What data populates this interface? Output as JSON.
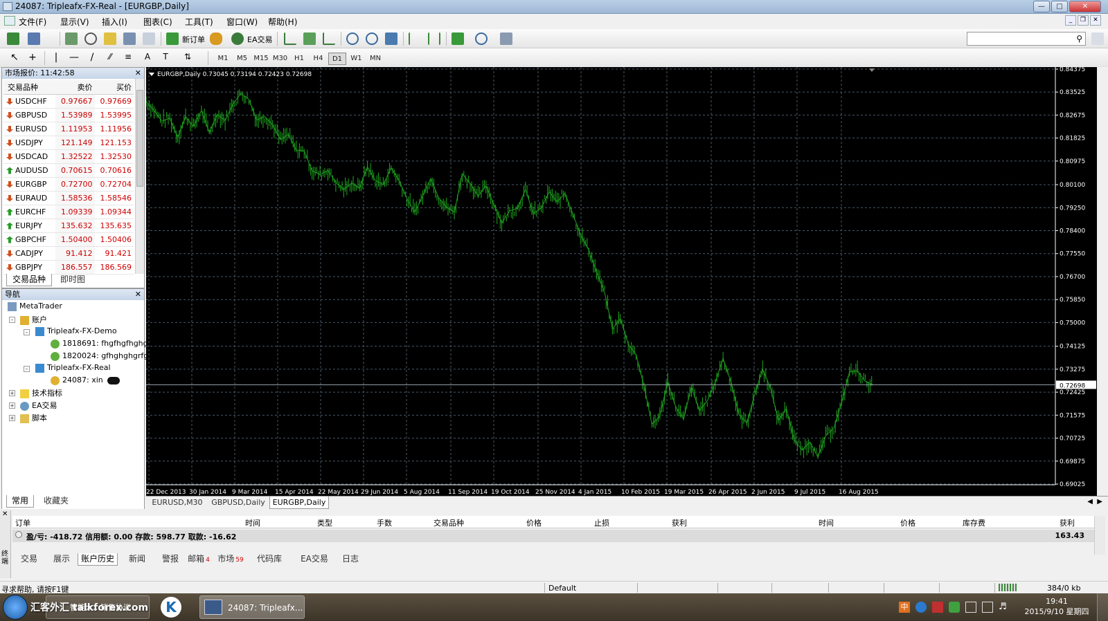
{
  "window": {
    "title": "24087: Tripleafx-FX-Real - [EURGBP,Daily]"
  },
  "menu": [
    "文件(F)",
    "显示(V)",
    "插入(I)",
    "图表(C)",
    "工具(T)",
    "窗口(W)",
    "帮助(H)"
  ],
  "toolbar": {
    "new_order": "新订单",
    "ea_trading": "EA交易"
  },
  "timeframes": [
    "M1",
    "M5",
    "M15",
    "M30",
    "H1",
    "H4",
    "D1",
    "W1",
    "MN"
  ],
  "active_timeframe": "D1",
  "market_watch": {
    "title": "市场报价: 11:42:58",
    "headers": [
      "交易品种",
      "卖价",
      "买价"
    ],
    "rows": [
      {
        "symbol": "USDCHF",
        "bid": "0.97667",
        "ask": "0.97669",
        "dir": "down"
      },
      {
        "symbol": "GBPUSD",
        "bid": "1.53989",
        "ask": "1.53995",
        "dir": "down"
      },
      {
        "symbol": "EURUSD",
        "bid": "1.11953",
        "ask": "1.11956",
        "dir": "down"
      },
      {
        "symbol": "USDJPY",
        "bid": "121.149",
        "ask": "121.153",
        "dir": "down"
      },
      {
        "symbol": "USDCAD",
        "bid": "1.32522",
        "ask": "1.32530",
        "dir": "down"
      },
      {
        "symbol": "AUDUSD",
        "bid": "0.70615",
        "ask": "0.70616",
        "dir": "up"
      },
      {
        "symbol": "EURGBP",
        "bid": "0.72700",
        "ask": "0.72704",
        "dir": "down"
      },
      {
        "symbol": "EURAUD",
        "bid": "1.58536",
        "ask": "1.58546",
        "dir": "down"
      },
      {
        "symbol": "EURCHF",
        "bid": "1.09339",
        "ask": "1.09344",
        "dir": "up"
      },
      {
        "symbol": "EURJPY",
        "bid": "135.632",
        "ask": "135.635",
        "dir": "up"
      },
      {
        "symbol": "GBPCHF",
        "bid": "1.50400",
        "ask": "1.50406",
        "dir": "up"
      },
      {
        "symbol": "CADJPY",
        "bid": "91.412",
        "ask": "91.421",
        "dir": "down"
      },
      {
        "symbol": "GBPJPY",
        "bid": "186.557",
        "ask": "186.569",
        "dir": "down"
      }
    ],
    "tabs": [
      "交易品种",
      "即时图"
    ]
  },
  "navigator": {
    "title": "导航",
    "items": {
      "root": "MetaTrader",
      "accounts": "账户",
      "demo_server": "Tripleafx-FX-Demo",
      "demo_acc1": "1818691: fhgfhgfhghg",
      "demo_acc2": "1820024: gfhghghgrfg",
      "real_server": "Tripleafx-FX-Real",
      "real_acc": "24087: xin",
      "indicators": "技术指标",
      "experts": "EA交易",
      "scripts": "脚本"
    },
    "tabs": [
      "常用",
      "收藏夹"
    ]
  },
  "chart": {
    "header": "EURGBP,Daily  0.73045 0.73194 0.72423 0.72698",
    "tabs": [
      "EURUSD,M30",
      "GBPUSD,Daily",
      "EURGBP,Daily"
    ],
    "active_tab": "EURGBP,Daily",
    "colors": {
      "bg": "#000000",
      "grid": "#4a5a68",
      "candle": "#1faa1f",
      "axis_text": "#ffffff"
    }
  },
  "chart_data": {
    "type": "line",
    "title": "EURGBP,Daily",
    "ylim": [
      0.69,
      0.8445
    ],
    "y_ticks": [
      "0.84375",
      "0.83525",
      "0.82675",
      "0.81825",
      "0.80975",
      "0.80100",
      "0.79250",
      "0.78400",
      "0.77550",
      "0.76700",
      "0.75850",
      "0.75000",
      "0.74125",
      "0.73275",
      "0.72425",
      "0.71575",
      "0.70725",
      "0.69875",
      "0.69025"
    ],
    "x_ticks": [
      "22 Dec 2013",
      "30 Jan 2014",
      "9 Mar 2014",
      "15 Apr 2014",
      "22 May 2014",
      "29 Jun 2014",
      "5 Aug 2014",
      "11 Sep 2014",
      "19 Oct 2014",
      "25 Nov 2014",
      "4 Jan 2015",
      "10 Feb 2015",
      "19 Mar 2015",
      "26 Apr 2015",
      "2 Jun 2015",
      "9 Jul 2015",
      "16 Aug 2015"
    ],
    "current_price": "0.72698",
    "series": [
      {
        "values": [
          0.8318,
          0.8285,
          0.8245,
          0.8256,
          0.8185,
          0.8262,
          0.8225,
          0.8284,
          0.8203,
          0.827,
          0.8247,
          0.8309,
          0.8348,
          0.8325,
          0.8249,
          0.8262,
          0.8232,
          0.8177,
          0.8196,
          0.8138,
          0.8135,
          0.8061,
          0.8048,
          0.8063,
          0.8019,
          0.7992,
          0.8016,
          0.7997,
          0.8076,
          0.8026,
          0.801,
          0.8072,
          0.8026,
          0.7958,
          0.7908,
          0.7969,
          0.8033,
          0.7962,
          0.7927,
          0.7908,
          0.805,
          0.8015,
          0.7967,
          0.8006,
          0.7937,
          0.7868,
          0.7913,
          0.7923,
          0.7992,
          0.7903,
          0.7925,
          0.7983,
          0.7947,
          0.7978,
          0.7901,
          0.7823,
          0.7769,
          0.7686,
          0.7612,
          0.7476,
          0.7514,
          0.7421,
          0.738,
          0.7266,
          0.7124,
          0.7154,
          0.7282,
          0.7189,
          0.7143,
          0.7262,
          0.7175,
          0.721,
          0.7278,
          0.7367,
          0.728,
          0.716,
          0.7128,
          0.7234,
          0.7328,
          0.7258,
          0.7138,
          0.7182,
          0.7066,
          0.7029,
          0.7058,
          0.7002,
          0.7082,
          0.7108,
          0.7202,
          0.7318,
          0.7322,
          0.7282,
          0.727
        ]
      }
    ]
  },
  "terminal": {
    "headers": [
      "订单",
      "时间",
      "类型",
      "手数",
      "交易品种",
      "价格",
      "止损",
      "获利",
      "时间",
      "价格",
      "库存费",
      "获利"
    ],
    "summary": "盈/亏: -418.72  信用额: 0.00  存款: 598.77  取款: -16.62",
    "total": "163.43",
    "tabs": [
      "交易",
      "展示",
      "账户历史",
      "新闻",
      "警报",
      "邮箱",
      "市场",
      "代码库",
      "EA交易",
      "日志"
    ],
    "mail_badge": "4",
    "market_badge": "59",
    "active_tab": "账户历史",
    "side_label": "终端"
  },
  "status": {
    "help": "寻求帮助, 请按F1键",
    "profile": "Default",
    "traffic": "384/0 kb"
  },
  "taskbar": {
    "watermark": "汇客外汇 talkforex.com",
    "item1": "智能大…销售协议",
    "item2": "24087: Tripleafx...",
    "time": "19:41",
    "date": "2015/9/10 星期四"
  }
}
